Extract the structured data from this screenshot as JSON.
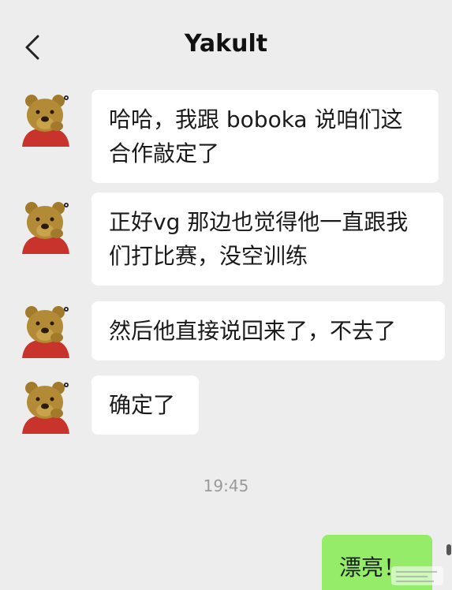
{
  "header": {
    "title": "Yakult",
    "back_icon": "chevron-left-icon"
  },
  "contact": {
    "avatar_icon": "bear-avatar-icon"
  },
  "messages": [
    {
      "direction": "incoming",
      "lines": [
        "哈哈，我跟 boboka 说咱们这",
        "合作敲定了"
      ]
    },
    {
      "direction": "incoming",
      "lines": [
        "正好vg 那边也觉得他一直跟我",
        "们打比赛，没空训练"
      ]
    },
    {
      "direction": "incoming",
      "lines": [
        "然后他直接说回来了，不去了"
      ]
    },
    {
      "direction": "incoming",
      "lines": [
        "确定了"
      ]
    }
  ],
  "timestamp": "19:45",
  "outgoing": {
    "text": "漂亮！"
  },
  "colors": {
    "background": "#ededed",
    "incoming_bubble": "#ffffff",
    "outgoing_bubble": "#95ec69",
    "timestamp": "#9a9a9a"
  }
}
